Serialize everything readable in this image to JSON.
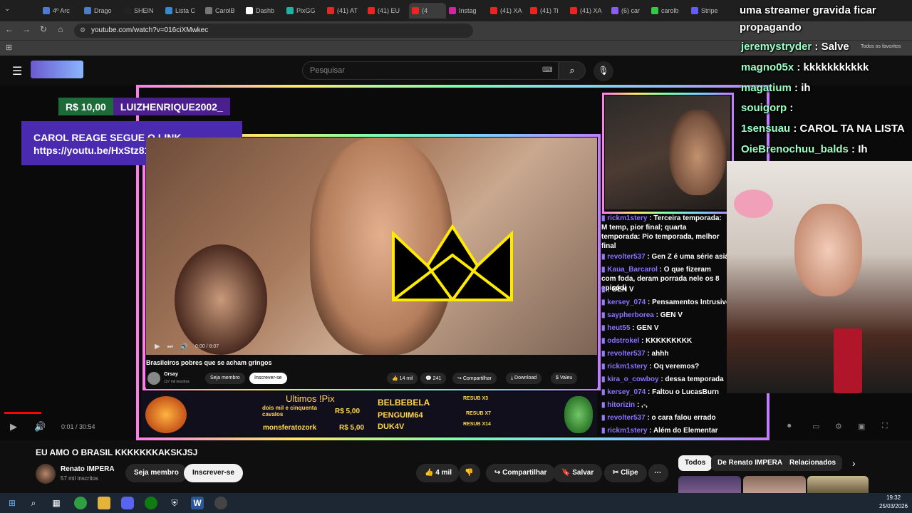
{
  "browser": {
    "tabs": [
      {
        "label": "4º Arc",
        "color": "#4e7bd1"
      },
      {
        "label": "Drago",
        "color": "#4e7bd1"
      },
      {
        "label": "SHEIN",
        "color": "#222"
      },
      {
        "label": "Lista C",
        "color": "#3a87d6"
      },
      {
        "label": "CarolB",
        "color": "#777"
      },
      {
        "label": "Dashb",
        "color": "#fff"
      },
      {
        "label": "PixGG",
        "color": "#1ab4a0"
      },
      {
        "label": "(41) AT",
        "color": "#e22"
      },
      {
        "label": "(41) EU",
        "color": "#e22"
      },
      {
        "label": "(4",
        "color": "#e22"
      },
      {
        "label": "Instag",
        "color": "#d6249f"
      },
      {
        "label": "(41) XA",
        "color": "#e22"
      },
      {
        "label": "(41) Ti",
        "color": "#e22"
      },
      {
        "label": "(41) XA",
        "color": "#e22"
      },
      {
        "label": "(6) car",
        "color": "#8a5cf6"
      },
      {
        "label": "carolb",
        "color": "#2ecc40"
      },
      {
        "label": "Stripe",
        "color": "#635bff"
      }
    ],
    "url": "youtube.com/watch?v=016ciXMwkec",
    "bookmarks_right": "Todos os favoritos"
  },
  "youtube": {
    "search_placeholder": "Pesquisar",
    "player_time": "0:01 / 30:54",
    "video_title": "EU AMO O BRASIL KKKKKKKAKSKJSJ",
    "channel_name": "Renato IMPERA",
    "subscribers": "57 mil inscritos",
    "member_label": "Seja membro",
    "subscribe_label": "Inscrever-se",
    "likes": "4 mil",
    "share_label": "Compartilhar",
    "save_label": "Salvar",
    "clip_label": "Clipe",
    "chips": [
      "Todos",
      "De Renato IMPERA",
      "Relacionados"
    ]
  },
  "stream": {
    "donation_amount": "R$ 10,00",
    "donation_user": "LUIZHENRIQUE2002_",
    "overlay_line1": "CAROL REAGE SEGUE O LINK",
    "overlay_line2": "https://youtu.be/HxStz81Itew",
    "inner_video": {
      "title": "Brasileiros pobres que se acham gringos",
      "time": "0:00 / 8:07",
      "channel": "Orsay",
      "subs": "127 mil inscritos",
      "member": "Seja membro",
      "subscribe": "Inscrever-se",
      "likes": "14 mil",
      "comments": "241",
      "share": "Compartilhar",
      "download": "Download",
      "thanks": "Valeu"
    },
    "pix": {
      "header": "Ultimos !Pix",
      "msg": "dois mil e cinquenta cavalos",
      "rows": [
        {
          "name": "monsferatozork",
          "amount": "R$ 5,00"
        },
        {
          "name": "",
          "amount": "R$ 5,00"
        }
      ],
      "amount_top": "R$ 5,00",
      "resubs": [
        {
          "name": "BELBEBELA",
          "tag": "RESUB X3"
        },
        {
          "name": "PENGUIM64",
          "tag": "RESUB X7"
        },
        {
          "name": "DUK4V",
          "tag": "RESUB X14"
        }
      ]
    },
    "big_chat": [
      {
        "name": "",
        "text": "uma streamer gravida ficar"
      },
      {
        "name": "",
        "text": "propagando"
      },
      {
        "name": "jeremystryder",
        "text": " : Salve"
      },
      {
        "name": "magno05x",
        "text": " : kkkkkkkkkkk"
      },
      {
        "name": "magatium",
        "text": " : ih"
      },
      {
        "name": "souigorp",
        "text": " :"
      },
      {
        "name": "1sensuau",
        "text": " : CAROL TA NA LISTA"
      },
      {
        "name": "OieBrenochuu_balds",
        "text": " : Ih"
      }
    ],
    "small_chat": [
      {
        "name": "rickm1stery",
        "text": " : Terceira temporada: M temp, pior final; quarta temporada: Pio temporada, melhor final"
      },
      {
        "name": "revolter537",
        "text": " : Gen Z é uma série asiá"
      },
      {
        "name": "Kaua_Barcarol",
        "text": " : O que fizeram com foda, deram porrada nele os 8 episódi"
      },
      {
        "name": "",
        "text": " : GEN V"
      },
      {
        "name": "kersey_074",
        "text": " : Pensamentos Intrusive"
      },
      {
        "name": "saypherborea",
        "text": " : GEN V"
      },
      {
        "name": "heut55",
        "text": " : GEN V"
      },
      {
        "name": "odstrokel",
        "text": " : KKKKKKKKK"
      },
      {
        "name": "revolter537",
        "text": " : ahhh"
      },
      {
        "name": "rickm1stery",
        "text": " : Oq veremos?"
      },
      {
        "name": "kira_o_cowboy",
        "text": " : dessa temporada"
      },
      {
        "name": "kersey_074",
        "text": " : Faltou o LucasBurn"
      },
      {
        "name": "hitorizin",
        "text": " : ,-,"
      },
      {
        "name": "revolter537",
        "text": " : o cara falou errado"
      },
      {
        "name": "rickm1stery",
        "text": " : Além do Elementar"
      }
    ]
  },
  "taskbar": {
    "time": "19:32",
    "date": "25/03/2026"
  }
}
